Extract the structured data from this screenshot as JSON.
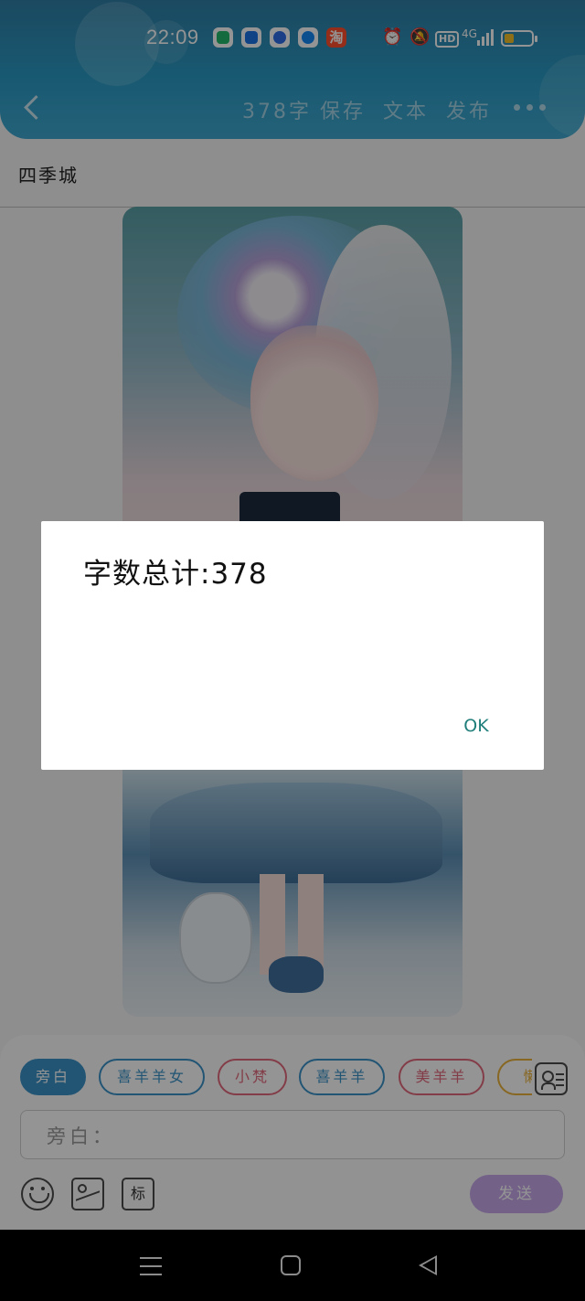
{
  "status_bar": {
    "time": "22:09",
    "network": "4G",
    "icons": [
      "app-icon-green",
      "app-icon-blue",
      "app-icon-blue-2",
      "app-icon-messenger",
      "taobao-icon",
      "alarm-icon",
      "mute-icon",
      "hd-icon",
      "signal-icon",
      "battery-icon"
    ],
    "taobao_label": "淘",
    "hd_label": "HD"
  },
  "toolbar": {
    "word_count": "378字",
    "save": "保存",
    "text": "文本",
    "publish": "发布"
  },
  "doc": {
    "title": "四季城"
  },
  "dialog": {
    "message": "字数总计:378",
    "ok": "OK"
  },
  "composer": {
    "chips": [
      {
        "label": "旁白"
      },
      {
        "label": "喜羊羊女"
      },
      {
        "label": "小梵"
      },
      {
        "label": "喜羊羊"
      },
      {
        "label": "美羊羊"
      },
      {
        "label": "懒"
      }
    ],
    "input_placeholder": "旁白：",
    "tag_label": "标",
    "send": "发送"
  },
  "colors": {
    "header": "#2a9ac4",
    "chip_blue": "#3b93c9",
    "chip_pink": "#e26a7d",
    "send": "#c6a8ea",
    "ok_text": "#1f7e7a"
  }
}
